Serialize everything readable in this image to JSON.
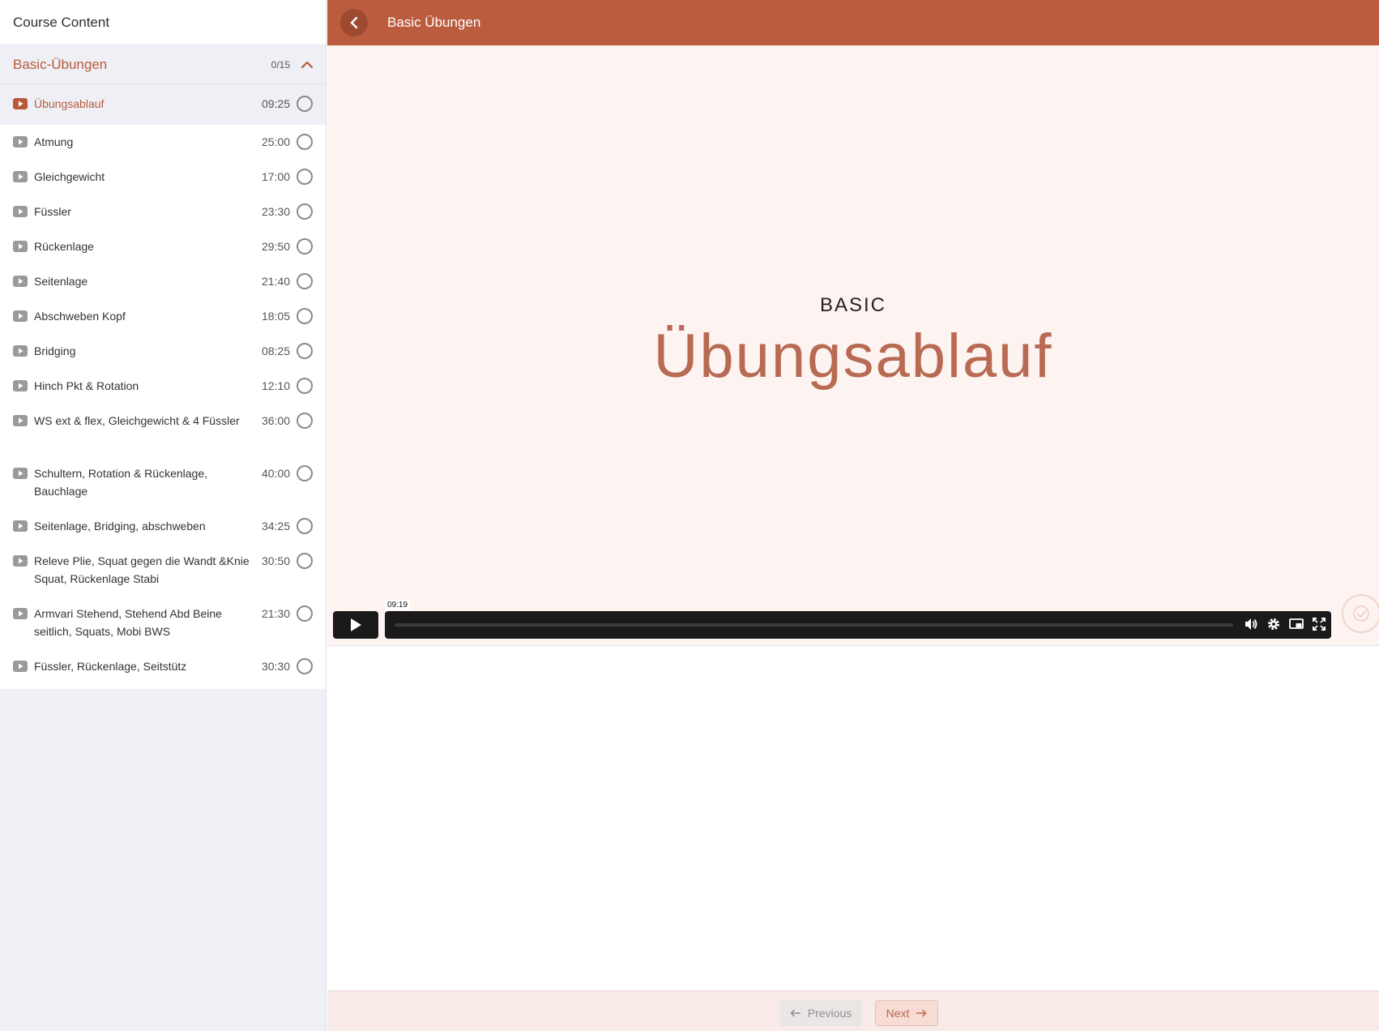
{
  "sidebar": {
    "header": "Course Content",
    "section": {
      "title": "Basic-Übungen",
      "count": "0/15"
    },
    "items": [
      {
        "label": "Übungsablauf",
        "duration": "09:25"
      },
      {
        "label": "Atmung",
        "duration": "25:00"
      },
      {
        "label": "Gleichgewicht",
        "duration": "17:00"
      },
      {
        "label": "Füssler",
        "duration": "23:30"
      },
      {
        "label": "Rückenlage",
        "duration": "29:50"
      },
      {
        "label": "Seitenlage",
        "duration": "21:40"
      },
      {
        "label": "Abschweben Kopf",
        "duration": "18:05"
      },
      {
        "label": "Bridging",
        "duration": "08:25"
      },
      {
        "label": "Hinch Pkt & Rotation",
        "duration": "12:10"
      },
      {
        "label": "WS ext & flex, Gleichgewicht & 4 Füssler",
        "duration": "36:00"
      },
      {
        "label": "Schultern, Rotation & Rückenlage, Bauchlage",
        "duration": "40:00"
      },
      {
        "label": "Seitenlage, Bridging, abschweben",
        "duration": "34:25"
      },
      {
        "label": "Releve Plie, Squat gegen die Wandt &Knie Squat, Rückenlage Stabi",
        "duration": "30:50"
      },
      {
        "label": "Armvari Stehend, Stehend Abd Beine seitlich, Squats, Mobi BWS",
        "duration": "21:30"
      },
      {
        "label": "Füssler, Rückenlage, Seitstütz",
        "duration": "30:30"
      }
    ]
  },
  "topbar": {
    "title": "Basic Übungen"
  },
  "video": {
    "kicker": "BASIC",
    "title": "Übungsablauf",
    "time_tooltip": "09:19",
    "progress_fraction": 0.0
  },
  "footer": {
    "previous": "Previous",
    "next": "Next"
  },
  "colors": {
    "accent": "#bb5c3e",
    "accent_text": "#b9593b",
    "video_bg": "#fdf3f1"
  },
  "icons": [
    "chevron-left-icon",
    "chevron-up-icon",
    "play-icon",
    "volume-icon",
    "gear-icon",
    "pip-icon",
    "fullscreen-icon",
    "check-icon",
    "arrow-left-icon",
    "arrow-right-icon"
  ]
}
